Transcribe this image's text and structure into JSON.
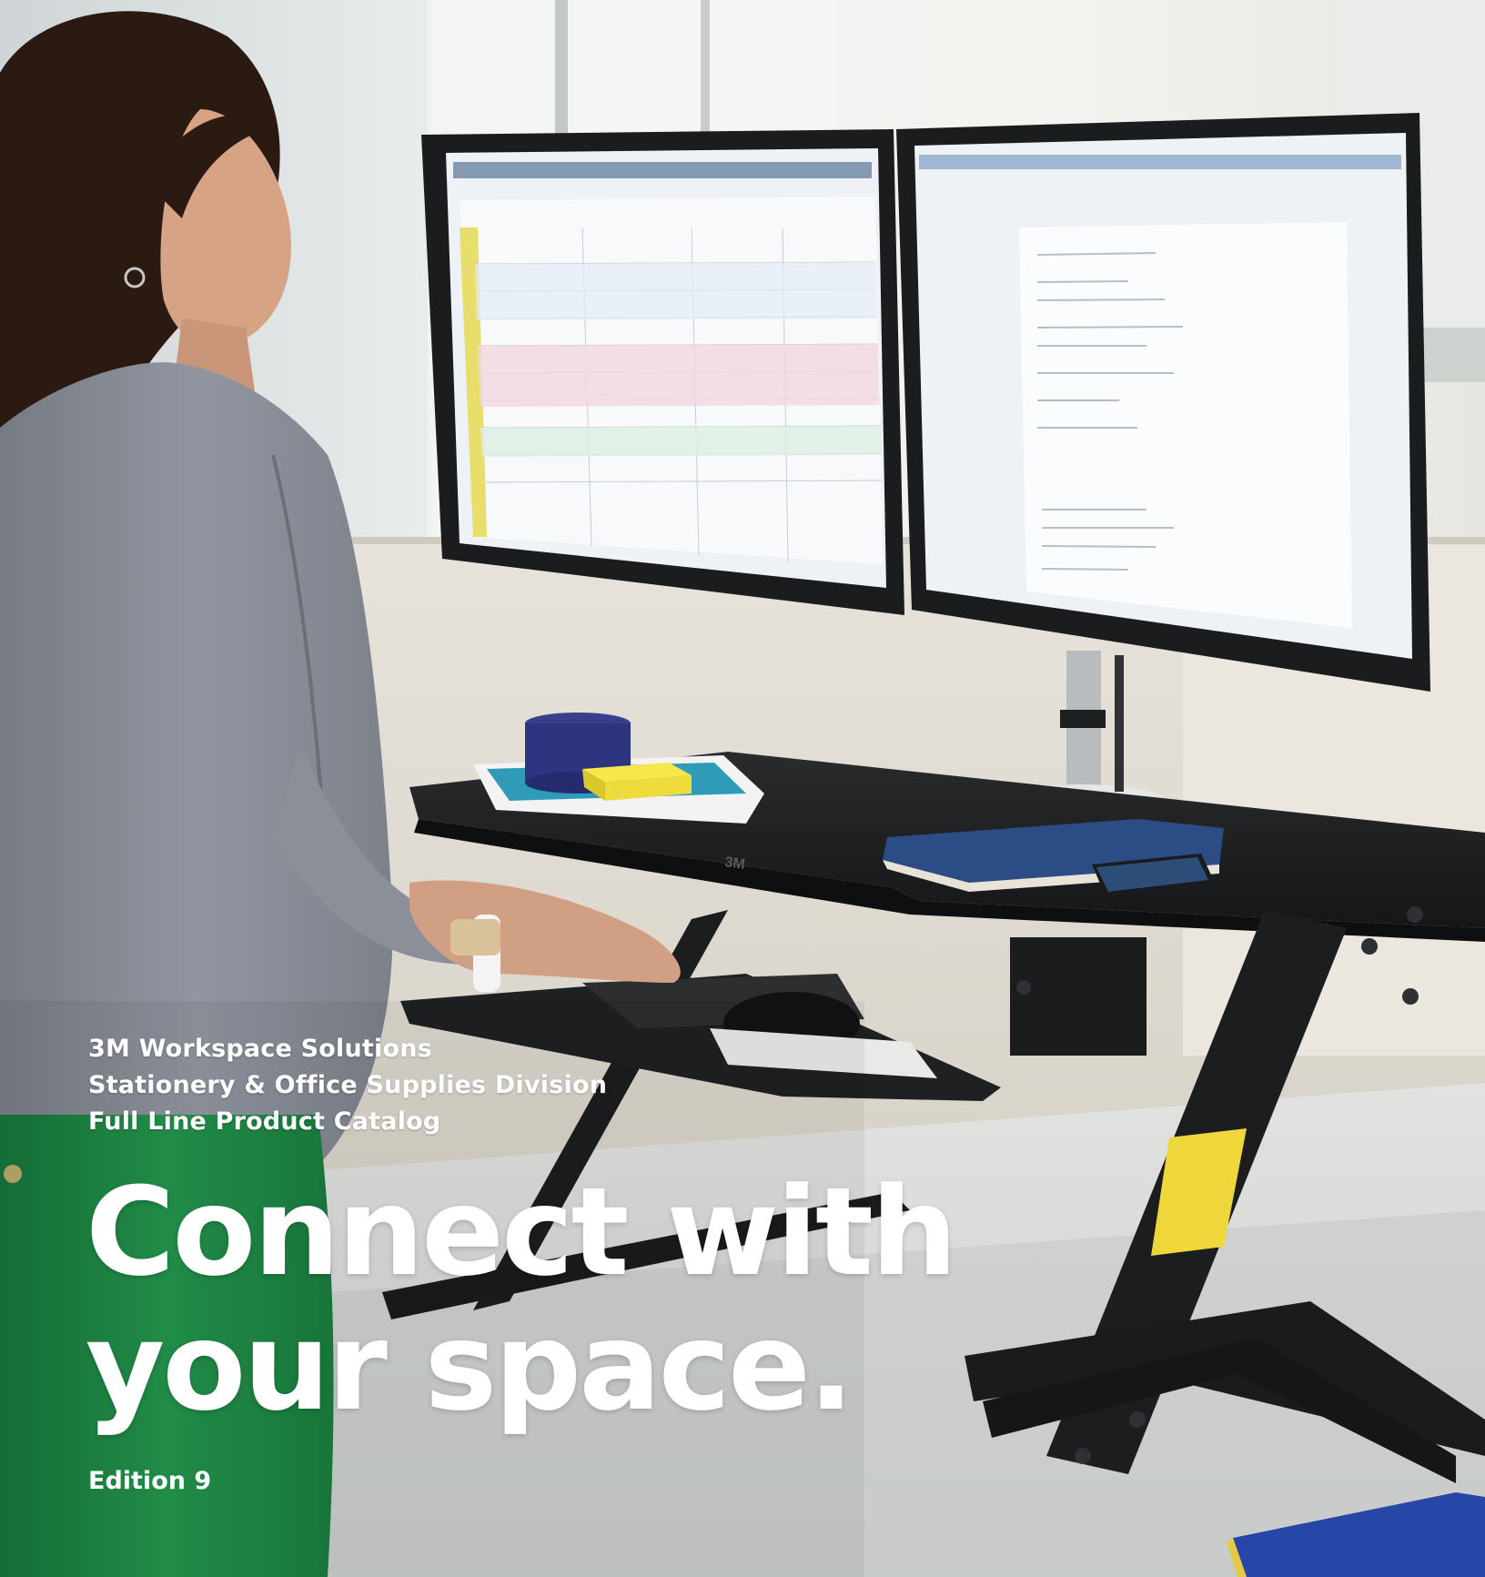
{
  "cover": {
    "subtitle_lines": [
      "3M Workspace Solutions",
      "Stationery & Office Supplies Division",
      "Full Line Product Catalog"
    ],
    "headline_lines": [
      "Connect with",
      "your space."
    ],
    "edition": "Edition 9"
  },
  "photo": {
    "desk_brand_mark": "3M"
  },
  "colors": {
    "text": "#ffffff",
    "pants_green": "#1f8a45",
    "blazer_gray": "#8b9099",
    "desk_black": "#1d1e20",
    "monitor_screen": "#e9eef4",
    "background_wall": "#e7e9e8"
  }
}
